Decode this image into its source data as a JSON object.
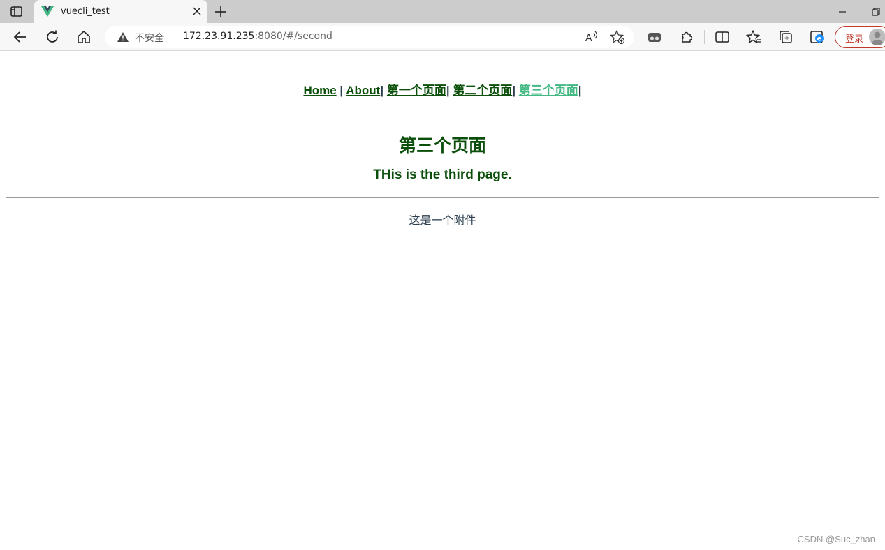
{
  "browser": {
    "tab": {
      "title": "vuecli_test"
    },
    "address_bar": {
      "security_label": "不安全",
      "url_host": "172.23.91.235",
      "url_rest": ":8080/#/second"
    },
    "login_label": "登录"
  },
  "page": {
    "nav": {
      "items": [
        {
          "label": "Home",
          "sep": " | "
        },
        {
          "label": "About",
          "sep": "| "
        },
        {
          "label": "第一个页面",
          "sep": "| "
        },
        {
          "label": "第二个页面",
          "sep": "| "
        },
        {
          "label": "第三个页面",
          "sep": "|"
        }
      ],
      "active_index": 4
    },
    "heading": "第三个页面",
    "subheading": "THis is the third page.",
    "attachment_text": "这是一个附件"
  },
  "watermark": "CSDN @Suc_zhan",
  "colors": {
    "link": "#0b4f0b",
    "active_link": "#42b983",
    "text": "#2c3e50",
    "login_accent": "#c0392b"
  },
  "icons": [
    "tab-actions-icon",
    "vue-logo-icon",
    "close-icon",
    "plus-icon",
    "minimize-icon",
    "restore-icon",
    "back-arrow-icon",
    "reload-icon",
    "home-icon",
    "warning-icon",
    "read-aloud-icon",
    "add-favorite-icon",
    "tab-groups-icon",
    "extensions-icon",
    "split-screen-icon",
    "favorites-icon",
    "collections-icon",
    "ie-mode-icon",
    "avatar"
  ]
}
